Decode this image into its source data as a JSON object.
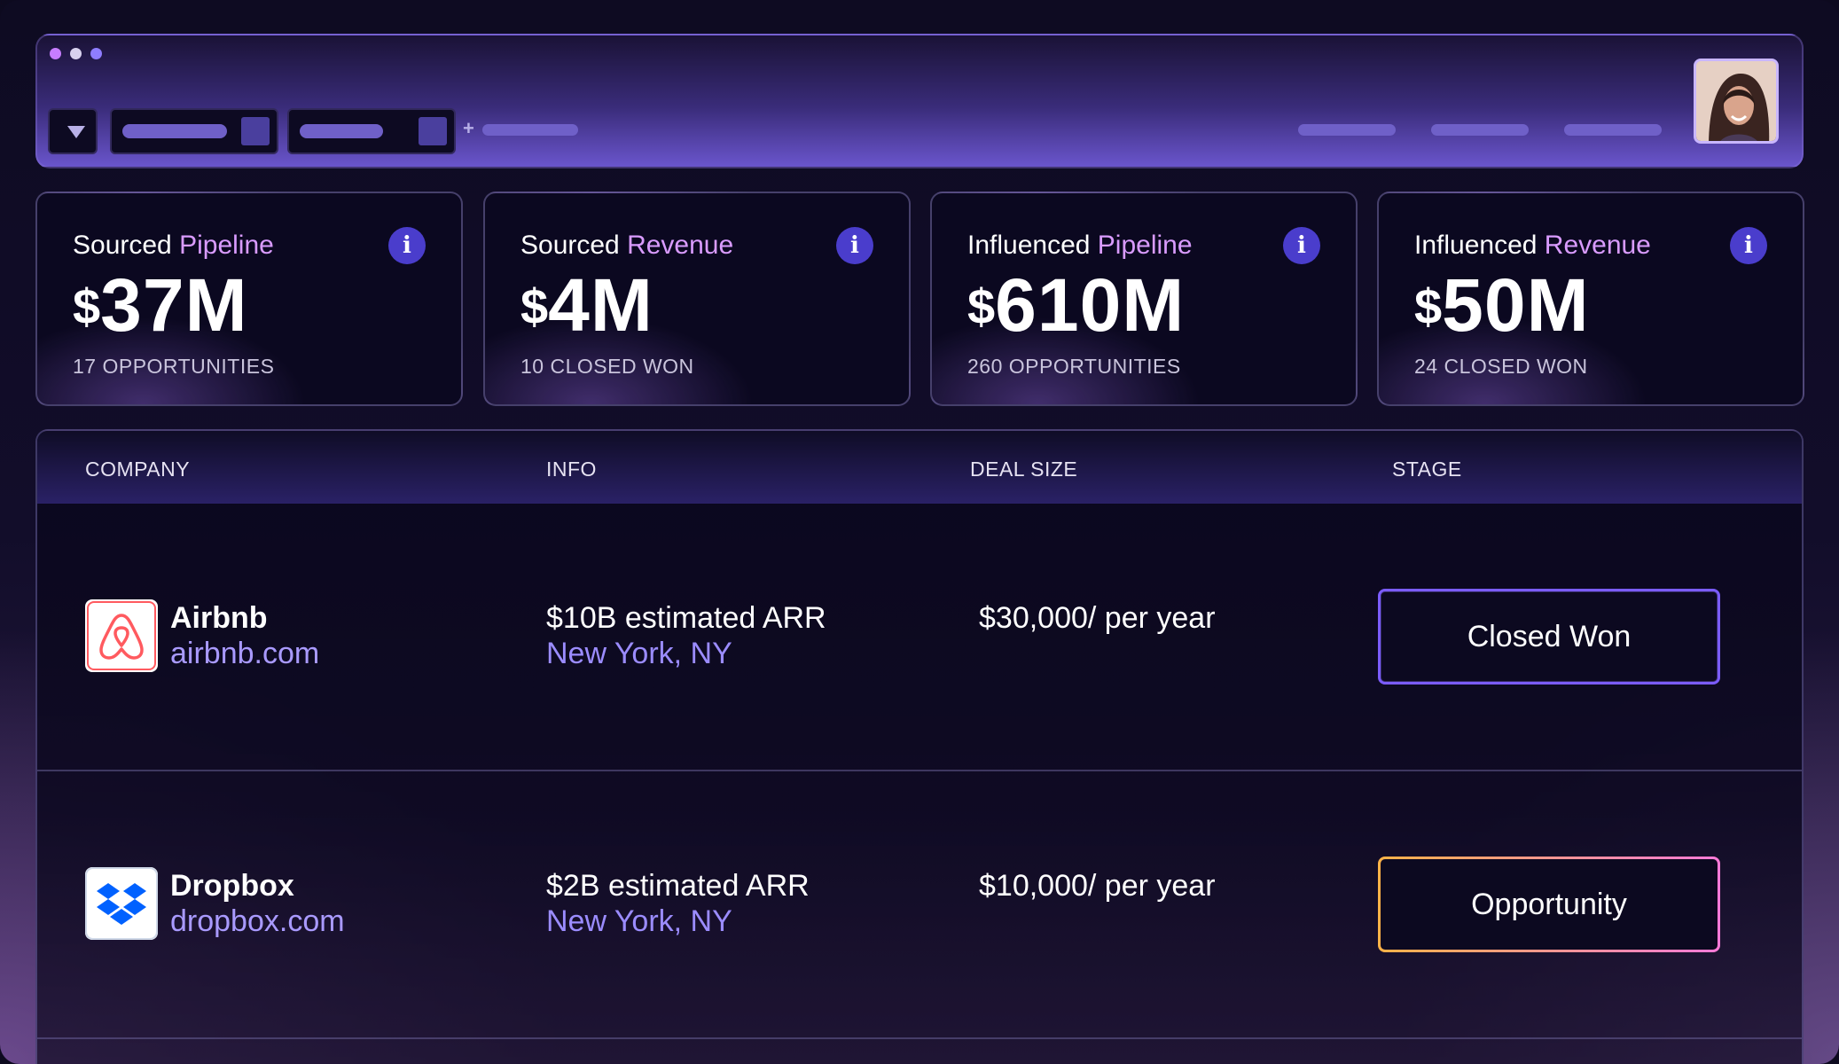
{
  "colors": {
    "accent": "#d99bff",
    "info_badge": "#4a3dcc",
    "link": "#9b8cff",
    "stage_won_border": "#7b5cff",
    "stage_opportunity_border_start": "#ffb347",
    "stage_opportunity_border_end": "#ff7ad9",
    "dot_1": "#c77dff",
    "dot_2": "#d8d2ee",
    "dot_3": "#8f7dff"
  },
  "icons": {
    "dropdown": "caret-down-icon",
    "add": "plus-icon",
    "info": "info-icon",
    "airbnb": "airbnb-logo",
    "dropbox": "dropbox-logo"
  },
  "add_symbol": "+",
  "info_symbol": "i",
  "stats": [
    {
      "title_main": "Sourced ",
      "title_accent": "Pipeline",
      "currency": "$",
      "value": "37M",
      "sub": "17 OPPORTUNITIES"
    },
    {
      "title_main": "Sourced ",
      "title_accent": "Revenue",
      "currency": "$",
      "value": "4M",
      "sub": "10 CLOSED WON"
    },
    {
      "title_main": "Influenced ",
      "title_accent": "Pipeline",
      "currency": "$",
      "value": "610M",
      "sub": "260 OPPORTUNITIES"
    },
    {
      "title_main": "Influenced ",
      "title_accent": "Revenue",
      "currency": "$",
      "value": "50M",
      "sub": "24 CLOSED WON"
    }
  ],
  "table": {
    "headers": [
      "COMPANY",
      "INFO",
      "DEAL SIZE",
      "STAGE"
    ],
    "rows": [
      {
        "company": "Airbnb",
        "domain": "airbnb.com",
        "arr": "$10B estimated ARR",
        "location": "New York, NY",
        "deal": "$30,000/ per year",
        "stage": "Closed Won"
      },
      {
        "company": "Dropbox",
        "domain": "dropbox.com",
        "arr": "$2B estimated ARR",
        "location": "New York, NY",
        "deal": "$10,000/ per year",
        "stage": "Opportunity"
      }
    ]
  }
}
